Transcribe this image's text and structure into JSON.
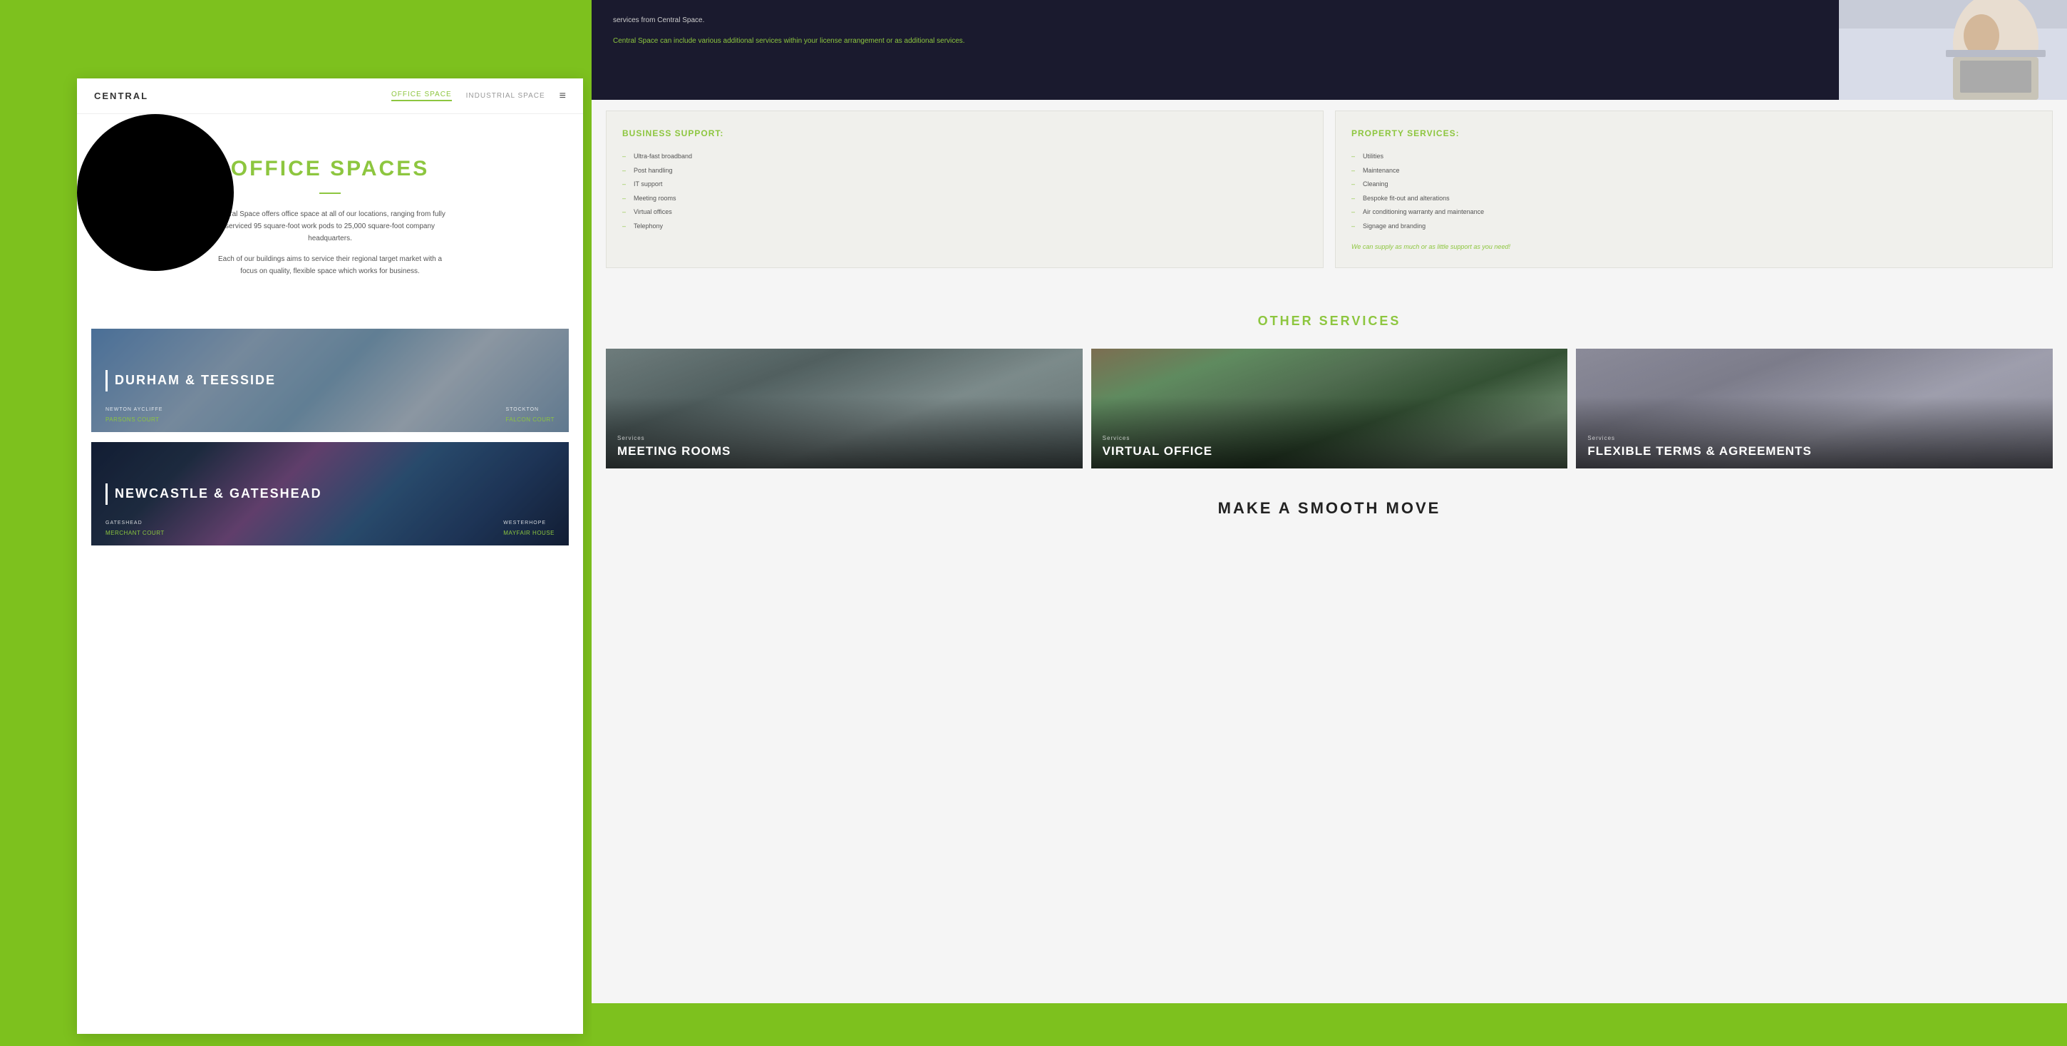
{
  "page": {
    "background_color": "#7dc11e"
  },
  "header": {
    "logo": "CENTRAL",
    "nav": [
      {
        "label": "OFFICE SPACE",
        "active": true
      },
      {
        "label": "INDUSTRIAL SPACE",
        "active": false
      }
    ],
    "menu_icon": "≡"
  },
  "hero": {
    "title": "OFFICE SPACES",
    "paragraph1": "Central Space offers office space at all of our locations, ranging from fully serviced 95 square-foot work pods to 25,000 square-foot company headquarters.",
    "paragraph2": "Each of our buildings aims to service their regional target market with a focus on quality, flexible space which works for business."
  },
  "locations": [
    {
      "title": "DURHAM & TEESSIDE",
      "sub_locations": [
        {
          "area": "NEWTON AYCLIFFE",
          "link": "PARSONS COURT"
        },
        {
          "area": "STOCKTON",
          "link": "FALCON COURT"
        }
      ]
    },
    {
      "title": "NEWCASTLE & GATESHEAD",
      "sub_locations": [
        {
          "area": "GATESHEAD",
          "link": "MERCHANT COURT"
        },
        {
          "area": "WESTERHOPE",
          "link": "MAYFAIR HOUSE"
        }
      ]
    }
  ],
  "top_text": {
    "paragraph1": "services from Central Space.",
    "paragraph2": "Central Space can include various additional services within your license arrangement or as additional services.",
    "highlight_text": "Central Space can include various additional services within your license arrangement or as additional services."
  },
  "business_support": {
    "title": "BUSINESS SUPPORT:",
    "items": [
      "Ultra-fast broadband",
      "Post handling",
      "IT support",
      "Meeting rooms",
      "Virtual offices",
      "Telephony"
    ]
  },
  "property_services": {
    "title": "PROPERTY SERVICES:",
    "items": [
      "Utilities",
      "Maintenance",
      "Cleaning",
      "Bespoke fit-out and alterations",
      "Air conditioning warranty and maintenance",
      "Signage and branding"
    ],
    "note": "We can supply as much or as little support as you need!"
  },
  "other_services": {
    "title": "OTHER SERVICES",
    "cards": [
      {
        "tag": "Services",
        "name": "MEETING ROOMS"
      },
      {
        "tag": "Services",
        "name": "VIRTUAL OFFICE"
      },
      {
        "tag": "Services",
        "name": "FLEXIBLE TERMS & AGREEMENTS"
      }
    ]
  },
  "smooth_move": {
    "title": "MAKE A SMOOTH MOVE"
  }
}
